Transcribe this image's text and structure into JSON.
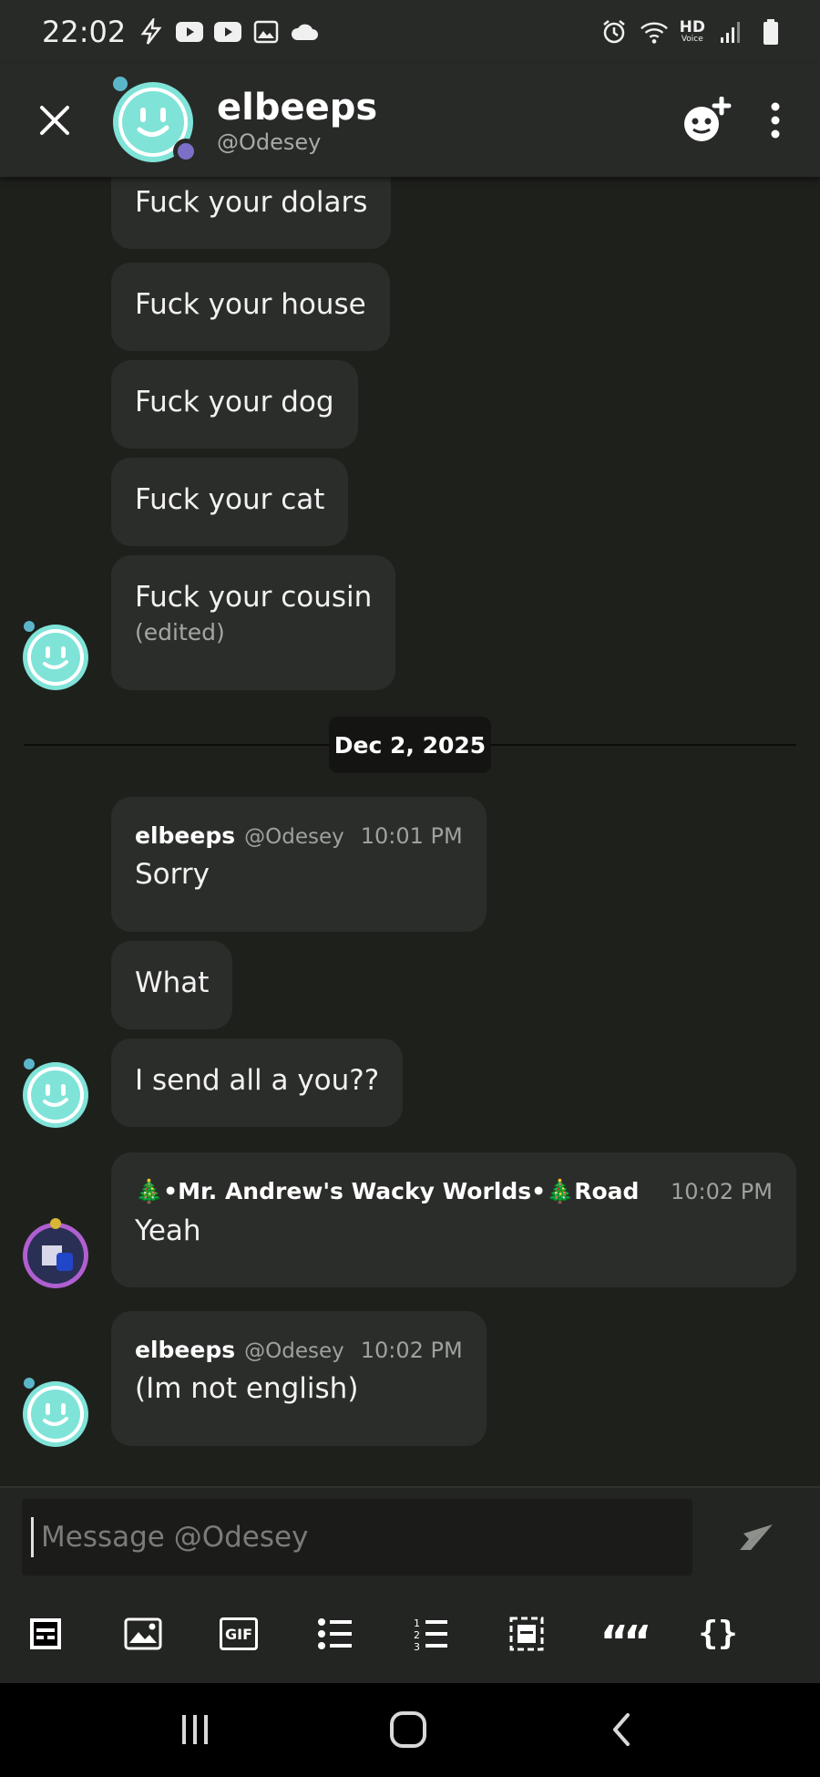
{
  "status_bar": {
    "time": "22:02",
    "left_icons": [
      "bolt-icon",
      "youtube-icon",
      "youtube-icon",
      "image-icon",
      "cloud-icon"
    ],
    "right_icons": [
      "alarm-icon",
      "wifi-icon",
      "hd-voice-icon",
      "signal-icon",
      "battery-icon"
    ],
    "hd_label": "HD",
    "voice_label": "Voice"
  },
  "header": {
    "name": "elbeeps",
    "handle": "@Odesey",
    "presence_color": "#7b6fc8"
  },
  "messages_top": [
    {
      "text": "Fuck your dolars"
    },
    {
      "text": "Fuck your house"
    },
    {
      "text": "Fuck your dog"
    },
    {
      "text": "Fuck your cat"
    },
    {
      "text": "Fuck your cousin",
      "edited": "(edited)"
    }
  ],
  "date_divider": "Dec 2, 2025",
  "group_one": {
    "author": "elbeeps",
    "handle": "@Odesey",
    "time": "10:01 PM",
    "messages": [
      "Sorry",
      "What",
      "I send all a you??"
    ]
  },
  "group_two": {
    "author": "🎄•Mr. Andrew's Wacky Worlds•🎄Road",
    "time": "10:02 PM",
    "messages": [
      "Yeah"
    ]
  },
  "group_three": {
    "author": "elbeeps",
    "handle": "@Odesey",
    "time": "10:02 PM",
    "messages": [
      "(Im not english)"
    ]
  },
  "composer": {
    "placeholder": "Message @Odesey"
  },
  "toolbar": {
    "items": [
      "spoiler-icon",
      "image-icon",
      "gif-icon",
      "bulleted-list-icon",
      "numbered-list-icon",
      "code-block-select-icon",
      "quote-icon",
      "code-braces-icon"
    ],
    "gif_label": "GIF",
    "quote_label": "““",
    "braces_label": "{}"
  },
  "colors": {
    "background": "#1e201c",
    "bubble": "#2b2d2a",
    "header": "#282a27",
    "avatar_teal": "#7fe3d8"
  }
}
